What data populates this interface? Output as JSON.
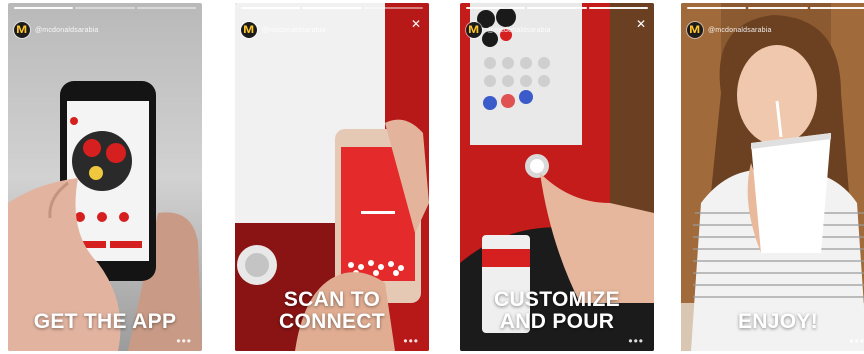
{
  "brand": {
    "logo_glyph": "M",
    "logo_color": "#ffc72c",
    "accent_red": "#d61f1f",
    "account_name": "@mcdonaldsarabia"
  },
  "icons": {
    "close": "✕",
    "more": "•••"
  },
  "stories": [
    {
      "caption": "GET THE APP",
      "progress_segments": 3,
      "active_segment": 1,
      "has_close": false
    },
    {
      "caption": "SCAN TO\nCONNECT",
      "progress_segments": 3,
      "active_segment": 2,
      "has_close": true
    },
    {
      "caption": "CUSTOMIZE\nAND POUR",
      "progress_segments": 3,
      "active_segment": 3,
      "has_close": true
    },
    {
      "caption": "ENJOY!",
      "progress_segments": 3,
      "active_segment": 3,
      "has_close": false
    }
  ]
}
